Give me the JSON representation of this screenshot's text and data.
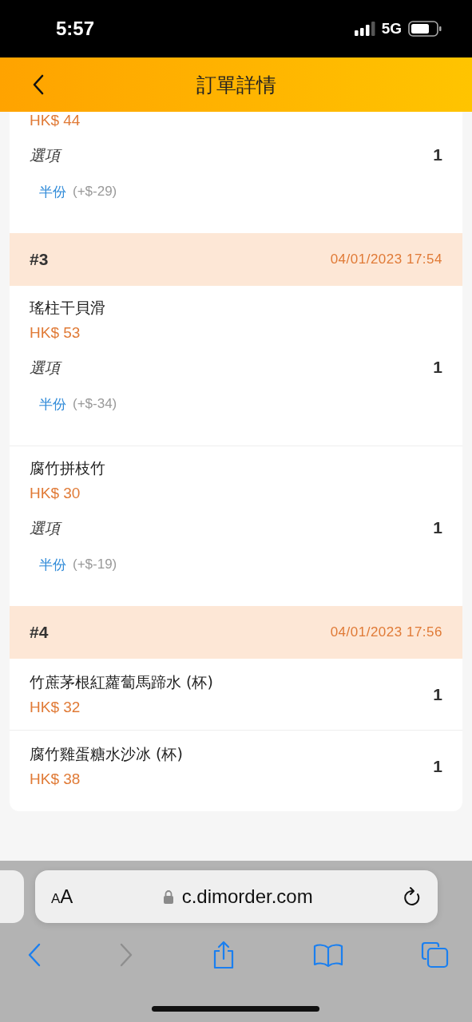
{
  "status_bar": {
    "time": "5:57",
    "network": "5G"
  },
  "header": {
    "title": "訂單詳情"
  },
  "partial_item": {
    "price": "HK$ 44",
    "options_label": "選項",
    "option": {
      "name": "半份",
      "price": "(+$-29)"
    },
    "quantity": "1"
  },
  "groups": [
    {
      "number": "#3",
      "time": "04/01/2023 17:54",
      "items": [
        {
          "name": "瑤柱干貝滑",
          "price": "HK$ 53",
          "options_label": "選項",
          "option": {
            "name": "半份",
            "price": "(+$-34)"
          },
          "quantity": "1"
        },
        {
          "name": "腐竹拼枝竹",
          "price": "HK$ 30",
          "options_label": "選項",
          "option": {
            "name": "半份",
            "price": "(+$-19)"
          },
          "quantity": "1"
        }
      ]
    },
    {
      "number": "#4",
      "time": "04/01/2023 17:56",
      "items": [
        {
          "name": "竹蔗茅根紅蘿蔔馬蹄水 (杯)",
          "price": "HK$ 32",
          "quantity": "1"
        },
        {
          "name": "腐竹雞蛋糖水沙冰 (杯)",
          "price": "HK$ 38",
          "quantity": "1"
        }
      ]
    }
  ],
  "browser": {
    "text_size": "AA",
    "url": "c.dimorder.com",
    "forward_disabled": true
  }
}
